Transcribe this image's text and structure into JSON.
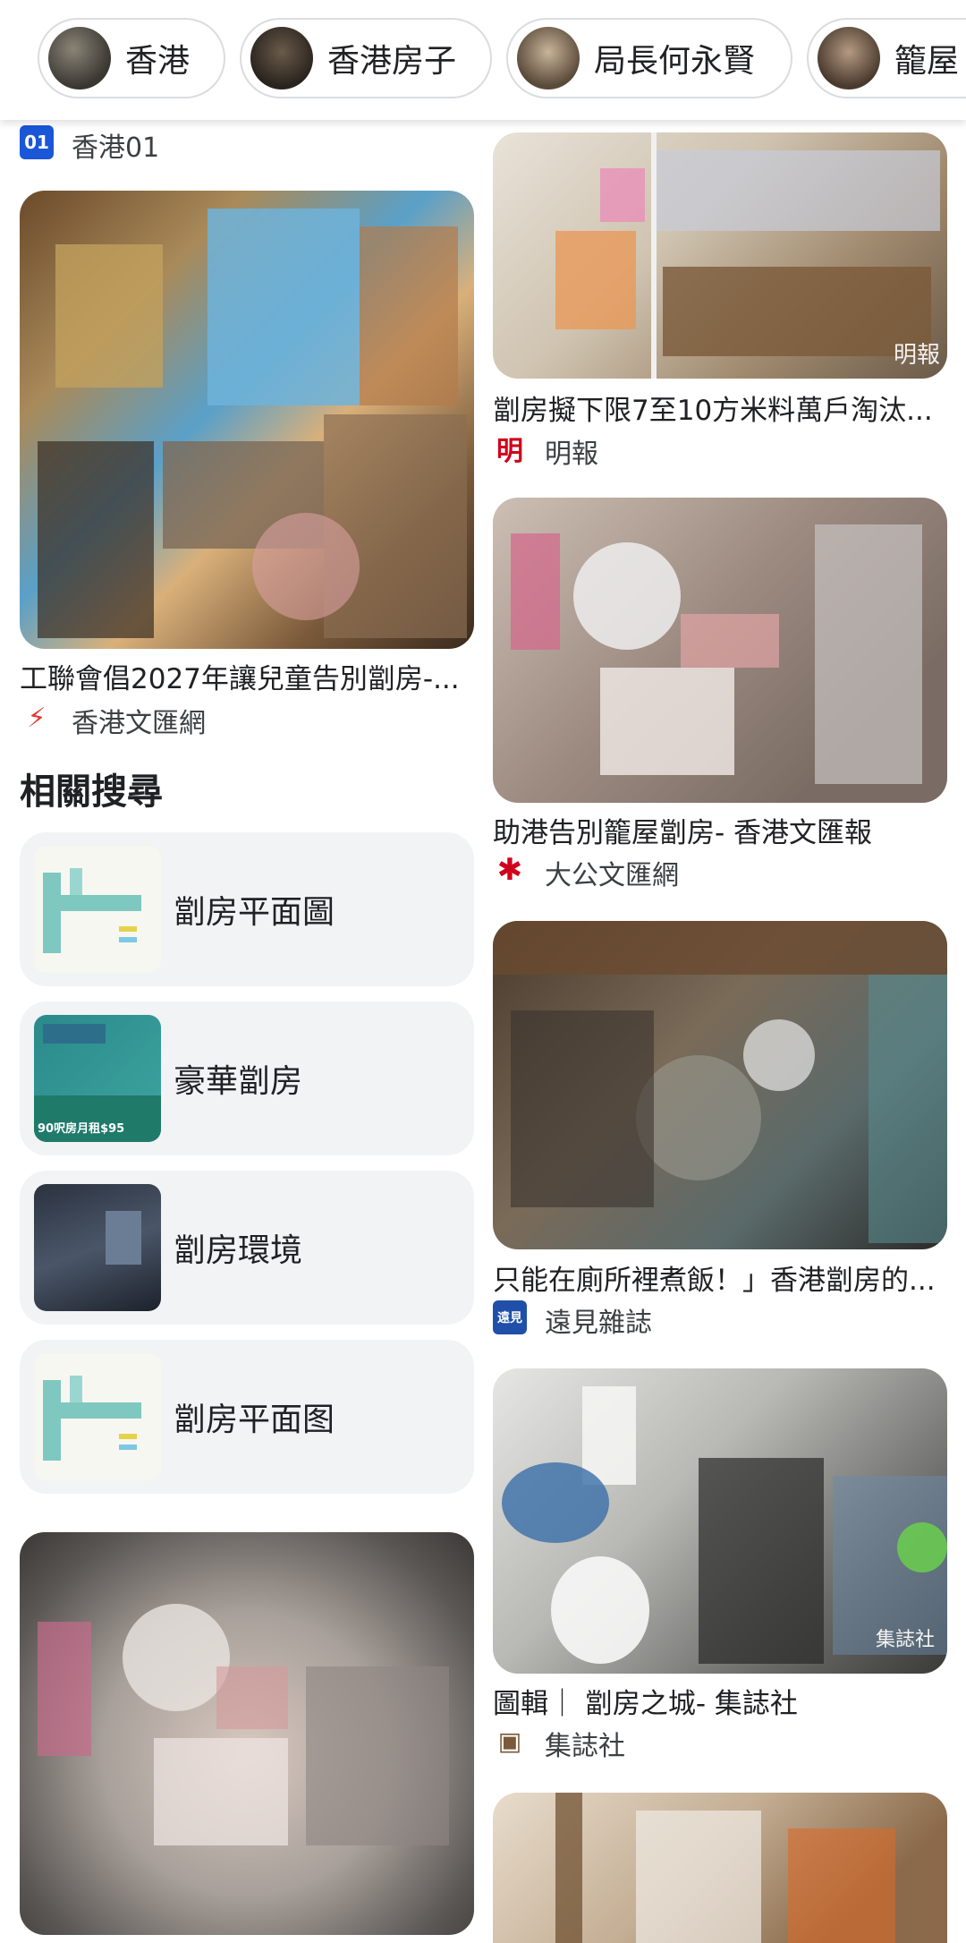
{
  "chips": [
    {
      "label": "香港"
    },
    {
      "label": "香港房子"
    },
    {
      "label": "局長何永賢"
    },
    {
      "label": "籠屋"
    }
  ],
  "left_column": {
    "top_source": {
      "name": "香港01",
      "icon": "hk01-logo-icon"
    },
    "card1": {
      "title": "工聯會倡2027年讓兒童告別劏房-...",
      "source": "香港文匯網",
      "icon": "wenweipo-logo-icon"
    },
    "related": {
      "heading": "相關搜尋",
      "items": [
        {
          "label": "劏房平面圖"
        },
        {
          "label": "豪華劏房",
          "thumb_text": "90呎房月租$95"
        },
        {
          "label": "劏房環境"
        },
        {
          "label": "劏房平面图"
        }
      ]
    }
  },
  "right_column": {
    "cards": [
      {
        "title": "劏房擬下限7至10方米料萬戶淘汰...",
        "source": "明報",
        "icon": "mingpao-logo-icon",
        "watermark": "明報"
      },
      {
        "title": "助港告別籠屋劏房- 香港文匯報",
        "source": "大公文匯網",
        "icon": "takungpao-logo-icon"
      },
      {
        "title": "只能在廁所裡煮飯！」香港劏房的...",
        "source": "遠見雜誌",
        "icon": "gvm-logo-icon",
        "icon_text": "遠見"
      },
      {
        "title": "圖輯｜ 劏房之城- 集誌社",
        "source": "集誌社",
        "icon": "collective-logo-icon",
        "watermark": "集誌社"
      }
    ]
  },
  "colors": {
    "chip_border": "#dadce0",
    "related_bg": "#f1f3f4",
    "hk01_blue": "#1a57d6",
    "mingpao_red": "#d0021b"
  }
}
